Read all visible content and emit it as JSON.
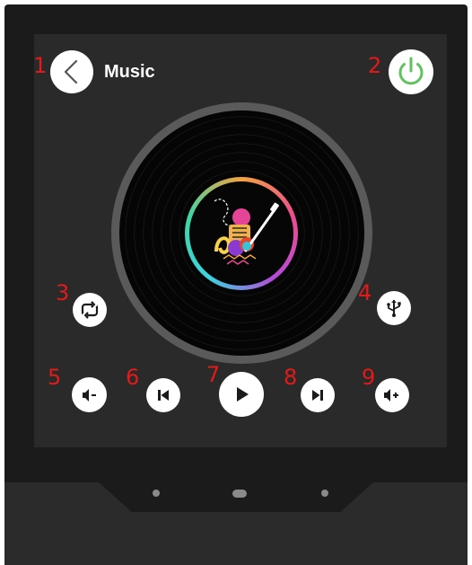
{
  "header": {
    "title": "Music"
  },
  "badges": {
    "b1": "1",
    "b2": "2",
    "b3": "3",
    "b4": "4",
    "b5": "5",
    "b6": "6",
    "b7": "7",
    "b8": "8",
    "b9": "9"
  },
  "icons": {
    "back": "chevron-left-icon",
    "power": "power-icon",
    "repeat": "repeat-icon",
    "usb": "usb-icon",
    "volume_down": "volume-down-icon",
    "previous": "skip-previous-icon",
    "play": "play-icon",
    "next": "skip-next-icon",
    "volume_up": "volume-up-icon"
  },
  "colors": {
    "accent_power": "#5fc35d",
    "badge": "#e21a1a",
    "screen_bg": "#2a2a2a",
    "device_bg": "#1b1b1b"
  }
}
